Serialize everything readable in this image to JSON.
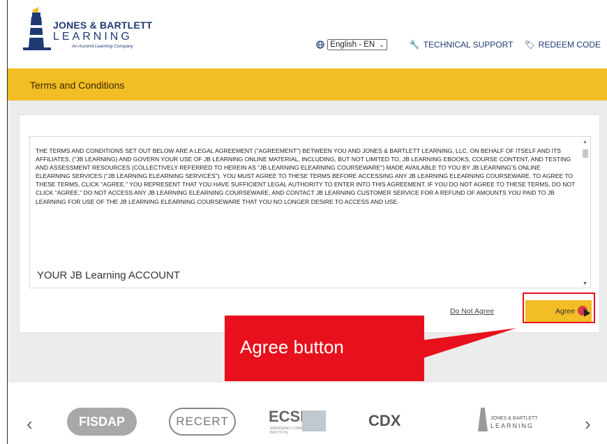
{
  "header": {
    "logo_line1": "JONES & BARTLETT",
    "logo_line2": "LEARNING",
    "logo_tagline": "An Ascend Learning Company",
    "language_value": "English - EN",
    "technical_support": "TECHNICAL SUPPORT",
    "redeem_code": "REDEEM CODE"
  },
  "banner": {
    "title": "Terms and Conditions"
  },
  "terms": {
    "body": "THE TERMS AND CONDITIONS SET OUT BELOW ARE A LEGAL AGREEMENT (\"AGREEMENT\") BETWEEN YOU AND JONES & BARTLETT LEARNING, LLC, ON BEHALF OF ITSELF AND ITS AFFILIATES, (\"JB LEARNING) AND GOVERN YOUR USE OF JB LEARNING ONLINE MATERIAL, INCLUDING, BUT NOT LIMITED TO, JB LEARNING EBOOKS, COURSE CONTENT, AND TESTING AND ASSESSMENT RESOURCES (COLLECTIVELY REFERRED TO HEREIN AS \"JB LEARNING ELEARNING COURSEWARE\") MADE AVAILABLE TO YOU BY JB LEARNING'S ONLINE ELEARNING SERVICES (\"JB LEARNING ELEARNING SERVICES\"). YOU MUST AGREE TO THESE TERMS BEFORE ACCESSING ANY JB LEARNING ELEARNING COURSEWARE. TO AGREE TO THESE TERMS, CLICK \"AGREE.\" YOU REPRESENT THAT YOU HAVE SUFFICIENT LEGAL AUTHORITY TO ENTER INTO THIS AGREEMENT. IF YOU DO NOT AGREE TO THESE TERMS, DO NOT CLICK \"AGREE,\" DO NOT ACCESS ANY JB LEARNING ELEARNING COURSEWARE, AND CONTACT JB LEARNING CUSTOMER SERVICE FOR A REFUND OF AMOUNTS YOU PAID TO JB LEARNING FOR USE OF THE JB LEARNING ELEARNING COURSEWARE THAT YOU NO LONGER DESIRE TO ACCESS AND USE.",
    "section_heading": "YOUR JB Learning ACCOUNT"
  },
  "actions": {
    "do_not_agree": "Do Not Agree",
    "agree": "Agree"
  },
  "callout": {
    "text": "Agree button"
  },
  "footer": {
    "brands": [
      "FISDAP",
      "RECERT",
      "ECSI",
      "EMERGENCY CARE & SAFETY INSTITUTE",
      "CDX",
      "JONES & BARTLETT",
      "LEARNING"
    ]
  },
  "colors": {
    "accent_yellow": "#f2bd25",
    "brand_navy": "#1f3a73",
    "callout_red": "#e8101c"
  }
}
